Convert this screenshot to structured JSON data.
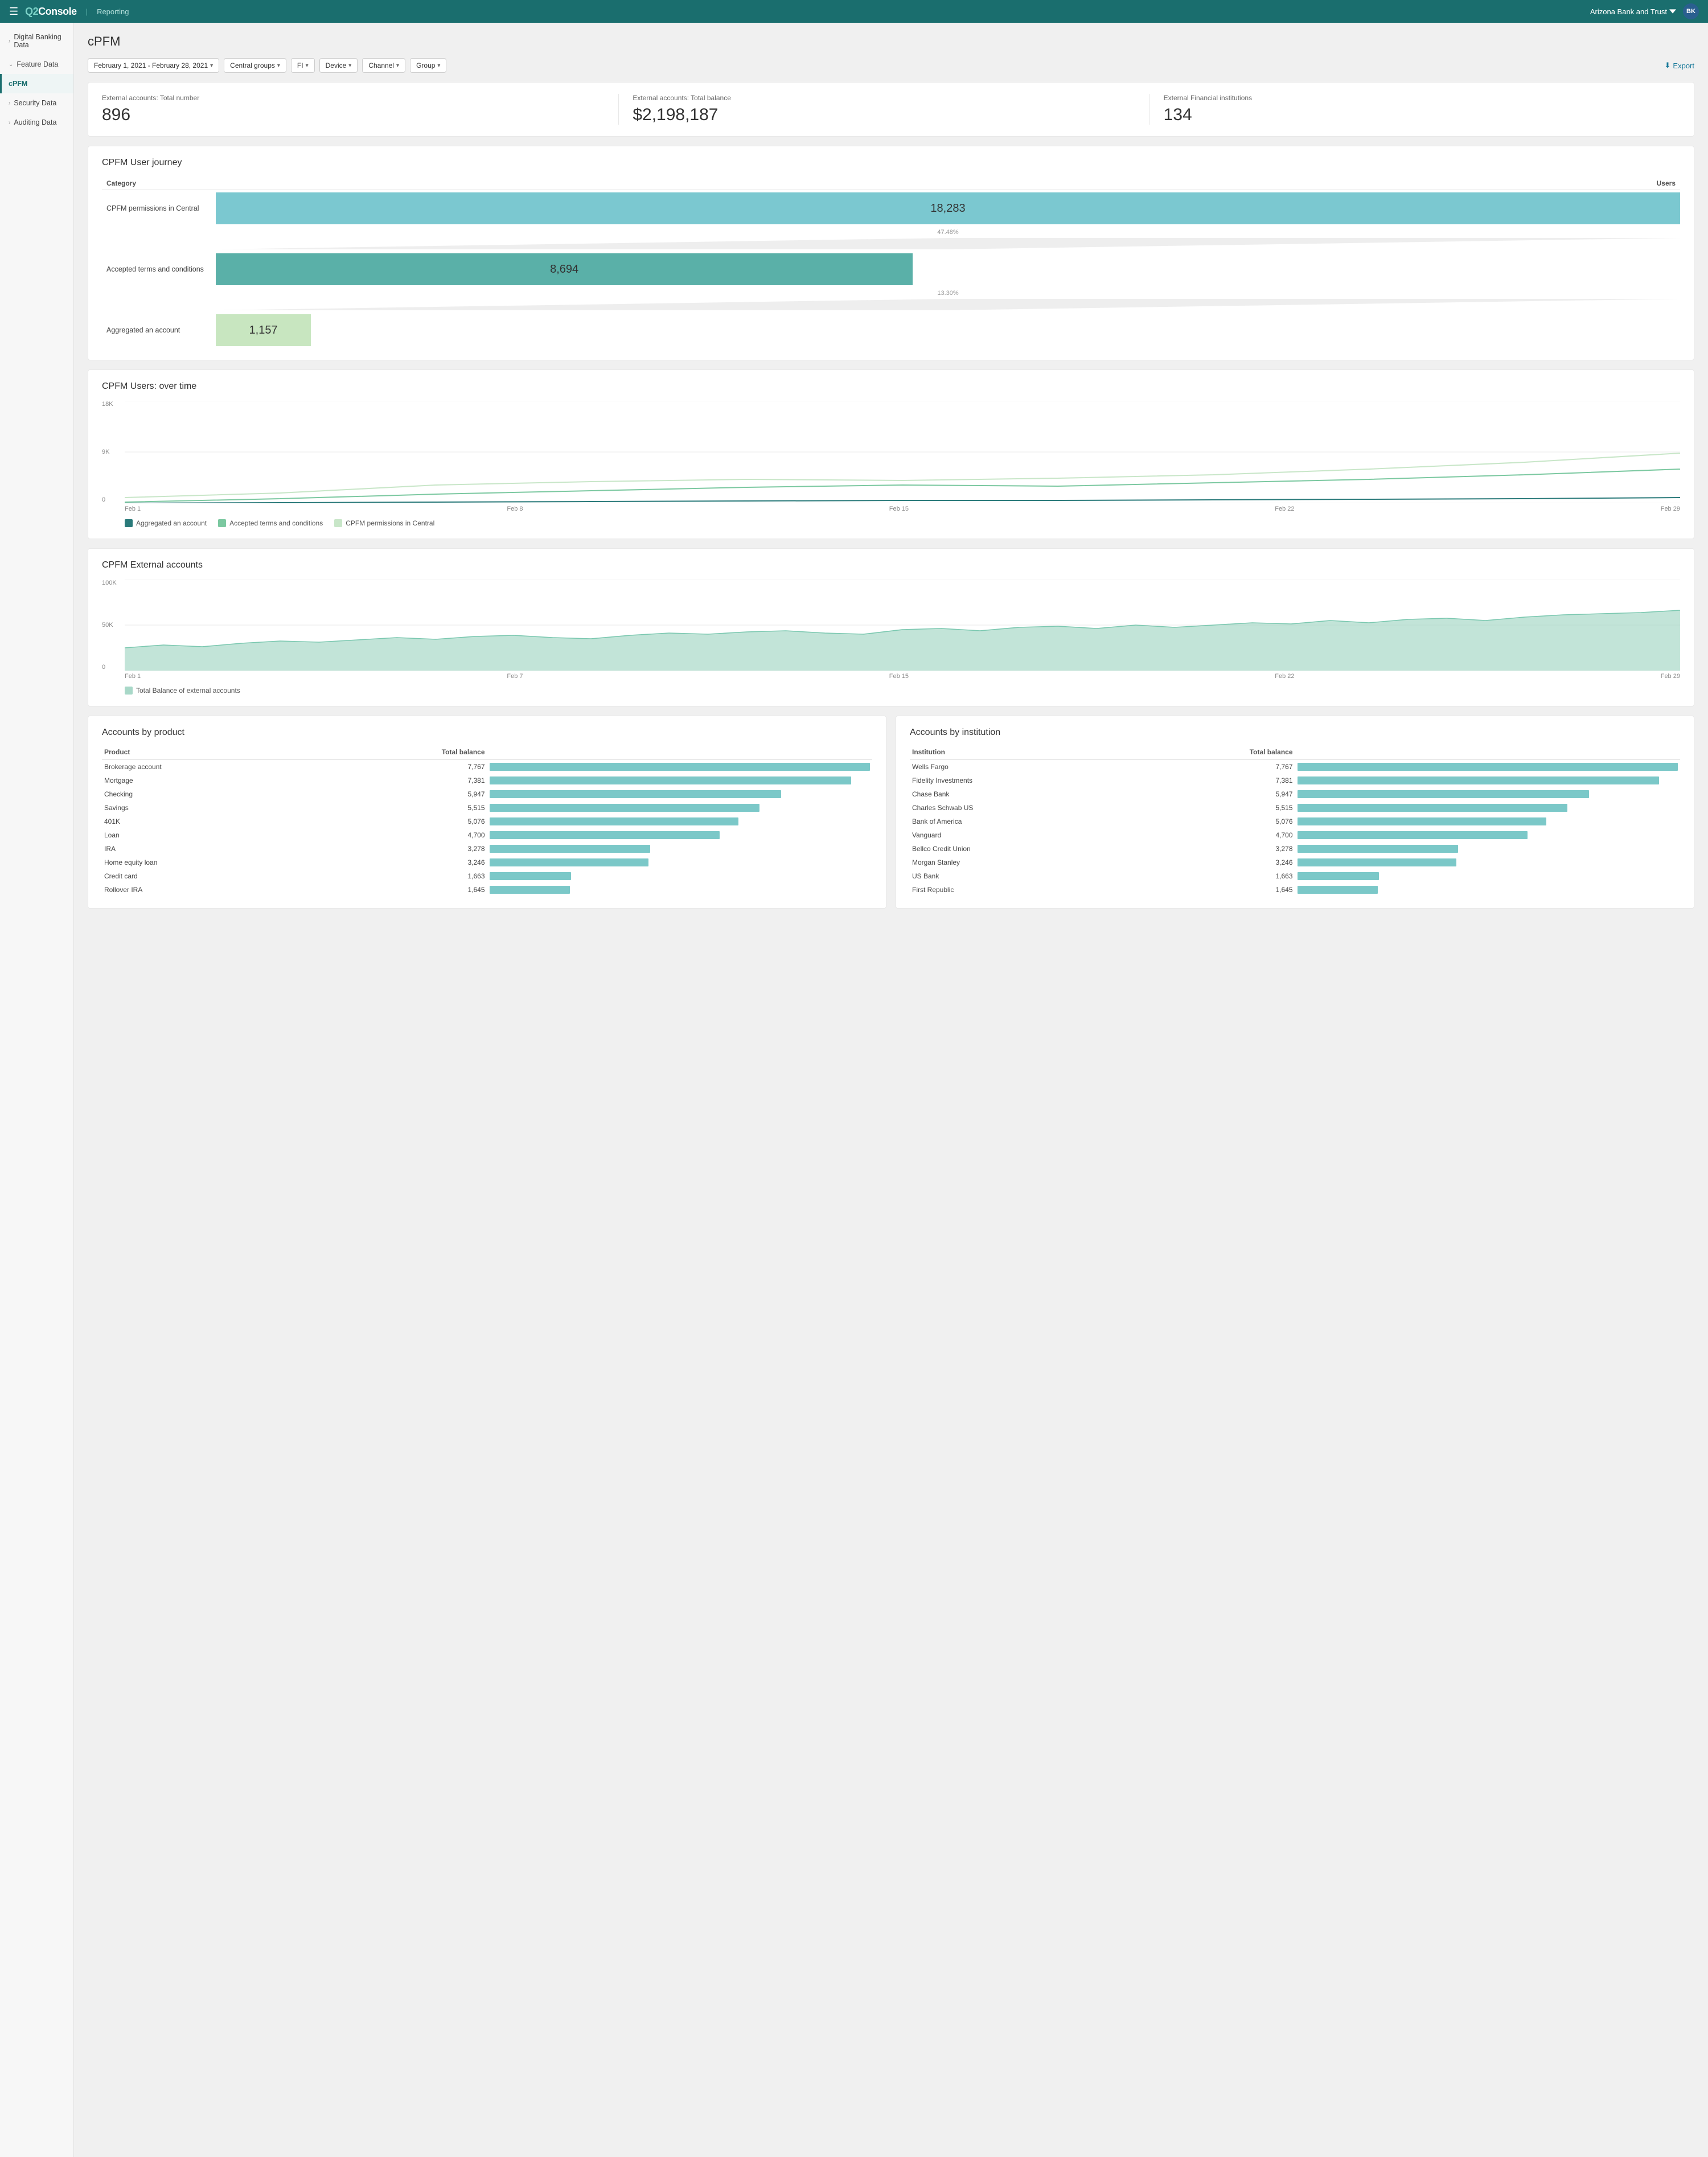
{
  "nav": {
    "logo": "Q2",
    "logo_suffix": "Console",
    "reporting": "Reporting",
    "bank": "Arizona Bank and Trust",
    "avatar": "BK"
  },
  "sidebar": {
    "items": [
      {
        "id": "digital-banking",
        "label": "Digital Banking Data",
        "expandable": true,
        "active": false
      },
      {
        "id": "feature-data",
        "label": "Feature Data",
        "expandable": true,
        "active": false
      },
      {
        "id": "cpfm",
        "label": "cPFM",
        "expandable": false,
        "active": true
      },
      {
        "id": "security-data",
        "label": "Security Data",
        "expandable": true,
        "active": false
      },
      {
        "id": "auditing-data",
        "label": "Auditing Data",
        "expandable": true,
        "active": false
      }
    ]
  },
  "page": {
    "title": "cPFM"
  },
  "filters": {
    "date_range": "February 1, 2021 - February 28, 2021",
    "central_groups": "Central groups",
    "fi": "FI",
    "device": "Device",
    "channel": "Channel",
    "group": "Group",
    "export": "Export"
  },
  "stats": [
    {
      "label": "External accounts: Total number",
      "value": "896"
    },
    {
      "label": "External accounts: Total balance",
      "value": "$2,198,187"
    },
    {
      "label": "External Financial institutions",
      "value": "134"
    }
  ],
  "funnel": {
    "title": "CPFM User journey",
    "col_category": "Category",
    "col_users": "Users",
    "rows": [
      {
        "label": "CPFM  permissions in Central",
        "value": "18,283",
        "pct": null,
        "width_pct": 100,
        "color": "blue"
      },
      {
        "label": "",
        "pct": "47.48%",
        "connector": true
      },
      {
        "label": "Accepted terms and conditions",
        "value": "8,694",
        "pct": null,
        "width_pct": 47.6,
        "color": "teal"
      },
      {
        "label": "",
        "pct": "13.30%",
        "connector": true
      },
      {
        "label": "Aggregated an account",
        "value": "1,157",
        "pct": null,
        "width_pct": 6.5,
        "color": "green"
      }
    ]
  },
  "line_chart": {
    "title": "CPFM Users: over time",
    "y_labels": [
      "18K",
      "9K",
      "0"
    ],
    "x_labels": [
      "Feb 1",
      "Feb 8",
      "Feb 15",
      "Feb 22",
      "Feb 29"
    ],
    "legend": [
      {
        "label": "Aggregated an account",
        "color": "#2a7a7a"
      },
      {
        "label": "Accepted terms and conditions",
        "color": "#7bc8a0"
      },
      {
        "label": "CPFM permissions in Central",
        "color": "#c8e6c8"
      }
    ]
  },
  "area_chart": {
    "title": "CPFM External accounts",
    "y_labels": [
      "100K",
      "50K",
      "0"
    ],
    "x_labels": [
      "Feb 1",
      "Feb 7",
      "Feb 15",
      "Feb 22",
      "Feb 29"
    ],
    "legend_label": "Total Balance of external accounts",
    "legend_color": "#7bc8b0"
  },
  "accounts_by_product": {
    "title": "Accounts by product",
    "col_product": "Product",
    "col_balance": "Total balance",
    "rows": [
      {
        "product": "Brokerage account",
        "balance": 7767,
        "display": "7,767"
      },
      {
        "product": "Mortgage",
        "balance": 7381,
        "display": "7,381"
      },
      {
        "product": "Checking",
        "balance": 5947,
        "display": "5,947"
      },
      {
        "product": "Savings",
        "balance": 5515,
        "display": "5,515"
      },
      {
        "product": "401K",
        "balance": 5076,
        "display": "5,076"
      },
      {
        "product": "Loan",
        "balance": 4700,
        "display": "4,700"
      },
      {
        "product": "IRA",
        "balance": 3278,
        "display": "3,278"
      },
      {
        "product": "Home equity loan",
        "balance": 3246,
        "display": "3,246"
      },
      {
        "product": "Credit card",
        "balance": 1663,
        "display": "1,663"
      },
      {
        "product": "Rollover IRA",
        "balance": 1645,
        "display": "1,645"
      }
    ],
    "max": 7767
  },
  "accounts_by_institution": {
    "title": "Accounts by institution",
    "col_institution": "Institution",
    "col_balance": "Total balance",
    "rows": [
      {
        "institution": "Wells Fargo",
        "balance": 7767,
        "display": "7,767"
      },
      {
        "institution": "Fidelity Investments",
        "balance": 7381,
        "display": "7,381"
      },
      {
        "institution": "Chase Bank",
        "balance": 5947,
        "display": "5,947"
      },
      {
        "institution": "Charles Schwab US",
        "balance": 5515,
        "display": "5,515"
      },
      {
        "institution": "Bank of America",
        "balance": 5076,
        "display": "5,076"
      },
      {
        "institution": "Vanguard",
        "balance": 4700,
        "display": "4,700"
      },
      {
        "institution": "Bellco Credit Union",
        "balance": 3278,
        "display": "3,278"
      },
      {
        "institution": "Morgan Stanley",
        "balance": 3246,
        "display": "3,246"
      },
      {
        "institution": "US Bank",
        "balance": 1663,
        "display": "1,663"
      },
      {
        "institution": "First Republic",
        "balance": 1645,
        "display": "1,645"
      }
    ],
    "max": 7767
  }
}
